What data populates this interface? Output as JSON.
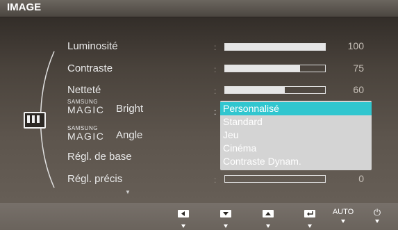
{
  "header": {
    "title": "IMAGE"
  },
  "menu": {
    "items": [
      {
        "label": "Luminosité",
        "value": "100",
        "level": 100
      },
      {
        "label": "Contraste",
        "value": "75",
        "level": 75
      },
      {
        "label": "Netteté",
        "value": "60",
        "level": 60
      }
    ],
    "magic_bright": {
      "brand_top": "SAMSUNG",
      "brand": "MAGIC",
      "word": "Bright"
    },
    "magic_angle": {
      "brand_top": "SAMSUNG",
      "brand": "MAGIC",
      "word": "Angle"
    },
    "regl_base": {
      "label": "Régl. de base"
    },
    "regl_precis": {
      "label": "Régl. précis",
      "value": "0",
      "level": 0
    },
    "colon": ":"
  },
  "dropdown": {
    "options": [
      "Personnalisé",
      "Standard",
      "Jeu",
      "Cinéma",
      "Contraste Dynam."
    ],
    "selected": "Personnalisé",
    "highlight_color": "#31c6cf"
  },
  "footer": {
    "buttons": [
      {
        "name": "left-button",
        "icon": "left-arrow-icon"
      },
      {
        "name": "down-button",
        "icon": "down-arrow-icon"
      },
      {
        "name": "up-button",
        "icon": "up-arrow-icon"
      },
      {
        "name": "enter-button",
        "icon": "enter-icon"
      },
      {
        "name": "auto-button",
        "label": "AUTO"
      },
      {
        "name": "power-button",
        "icon": "power-icon",
        "glyph": "⏻"
      }
    ]
  }
}
